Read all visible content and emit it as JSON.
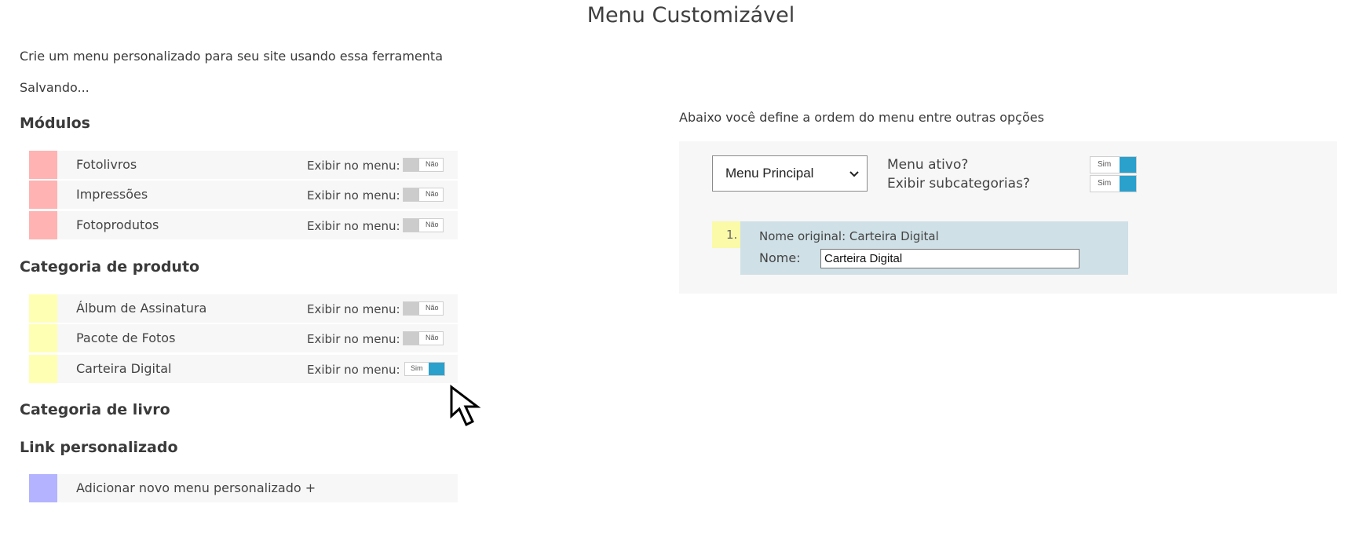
{
  "page": {
    "title": "Menu Customizável",
    "intro": "Crie um menu personalizado para seu site usando essa ferramenta",
    "status": "Salvando..."
  },
  "sections": {
    "modulos": {
      "title": "Módulos",
      "swatch_color": "#ffb3b3",
      "items": [
        {
          "label": "Fotolivros",
          "exibir_label": "Exibir no menu:",
          "toggle": "Não",
          "on": false
        },
        {
          "label": "Impressões",
          "exibir_label": "Exibir no menu:",
          "toggle": "Não",
          "on": false
        },
        {
          "label": "Fotoprodutos",
          "exibir_label": "Exibir no menu:",
          "toggle": "Não",
          "on": false
        }
      ]
    },
    "categoria_produto": {
      "title": "Categoria de produto",
      "swatch_color": "#ffffb3",
      "items": [
        {
          "label": "Álbum de Assinatura",
          "exibir_label": "Exibir no menu:",
          "toggle": "Não",
          "on": false
        },
        {
          "label": "Pacote de Fotos",
          "exibir_label": "Exibir no menu:",
          "toggle": "Não",
          "on": false
        },
        {
          "label": "Carteira Digital",
          "exibir_label": "Exibir no menu:",
          "toggle": "Sim",
          "on": true
        }
      ]
    },
    "categoria_livro": {
      "title": "Categoria de livro"
    },
    "link_personalizado": {
      "title": "Link personalizado",
      "swatch_color": "#b3b3ff",
      "add_label": "Adicionar novo menu personalizado +"
    }
  },
  "right": {
    "description": "Abaixo você define a ordem do menu entre outras opções",
    "menu_select": {
      "selected": "Menu Principal",
      "icon": "chevron-down-icon"
    },
    "menu_ativo": {
      "label": "Menu ativo?",
      "toggle": "Sim",
      "on": true
    },
    "exibir_subcategorias": {
      "label": "Exibir subcategorias?",
      "toggle": "Sim",
      "on": true
    },
    "menu_items": [
      {
        "number": "1.",
        "original_name": "Nome original: Carteira Digital",
        "name_label": "Nome:",
        "name_value": "Carteira Digital"
      }
    ]
  },
  "colors": {
    "toggle_on": "#2aa0cd",
    "toggle_off": "#cccccc",
    "row_bg": "#f7f7f7",
    "menu_item_bg": "#cfe0e6",
    "menu_number_bg": "#fafaa8"
  },
  "cursor": {
    "icon": "mouse-pointer-icon"
  }
}
